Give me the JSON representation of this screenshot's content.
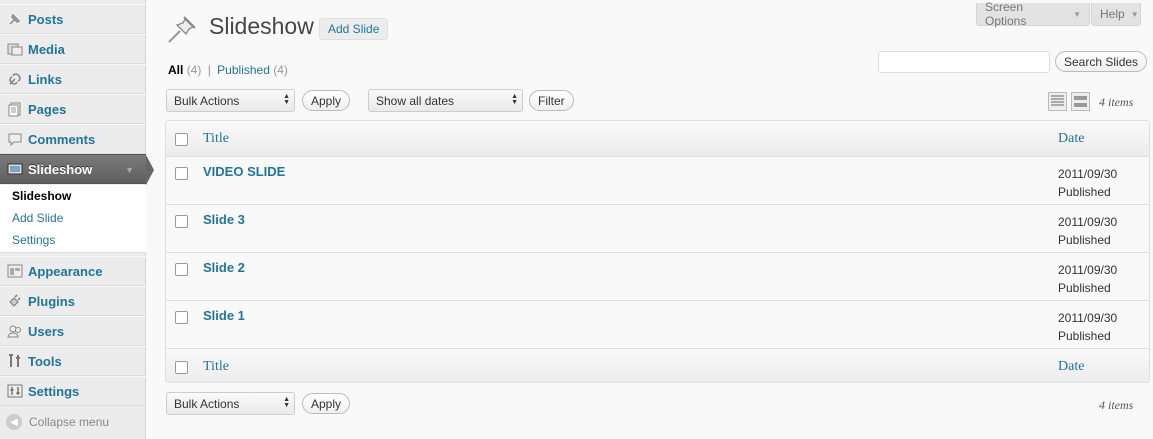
{
  "sidebar": {
    "items": [
      {
        "label": "Posts",
        "icon": "pushpin-icon"
      },
      {
        "label": "Media",
        "icon": "media-icon"
      },
      {
        "label": "Links",
        "icon": "link-icon"
      },
      {
        "label": "Pages",
        "icon": "pages-icon"
      },
      {
        "label": "Comments",
        "icon": "comment-icon"
      },
      {
        "label": "Slideshow",
        "icon": "slideshow-icon"
      },
      {
        "label": "Appearance",
        "icon": "appearance-icon"
      },
      {
        "label": "Plugins",
        "icon": "plugin-icon"
      },
      {
        "label": "Users",
        "icon": "users-icon"
      },
      {
        "label": "Tools",
        "icon": "tools-icon"
      },
      {
        "label": "Settings",
        "icon": "settings-icon"
      }
    ],
    "submenu": [
      "Slideshow",
      "Add Slide",
      "Settings"
    ],
    "collapse": "Collapse menu"
  },
  "header": {
    "screen_options": "Screen Options",
    "help": "Help",
    "title": "Slideshow",
    "add_new": "Add Slide"
  },
  "filters": {
    "all_label": "All",
    "all_count": "(4)",
    "separator": "|",
    "published_label": "Published",
    "published_count": "(4)",
    "search_button": "Search Slides",
    "search_value": ""
  },
  "tablenav": {
    "bulk_actions": "Bulk Actions",
    "apply": "Apply",
    "dates": "Show all dates",
    "filter": "Filter",
    "count": "4 items"
  },
  "table": {
    "columns": [
      "Title",
      "Date"
    ],
    "rows": [
      {
        "title": "VIDEO SLIDE",
        "date": "2011/09/30",
        "status": "Published"
      },
      {
        "title": "Slide 3",
        "date": "2011/09/30",
        "status": "Published"
      },
      {
        "title": "Slide 2",
        "date": "2011/09/30",
        "status": "Published"
      },
      {
        "title": "Slide 1",
        "date": "2011/09/30",
        "status": "Published"
      }
    ]
  },
  "colors": {
    "link": "#21759b",
    "current_menu": "#6b6b6b"
  }
}
